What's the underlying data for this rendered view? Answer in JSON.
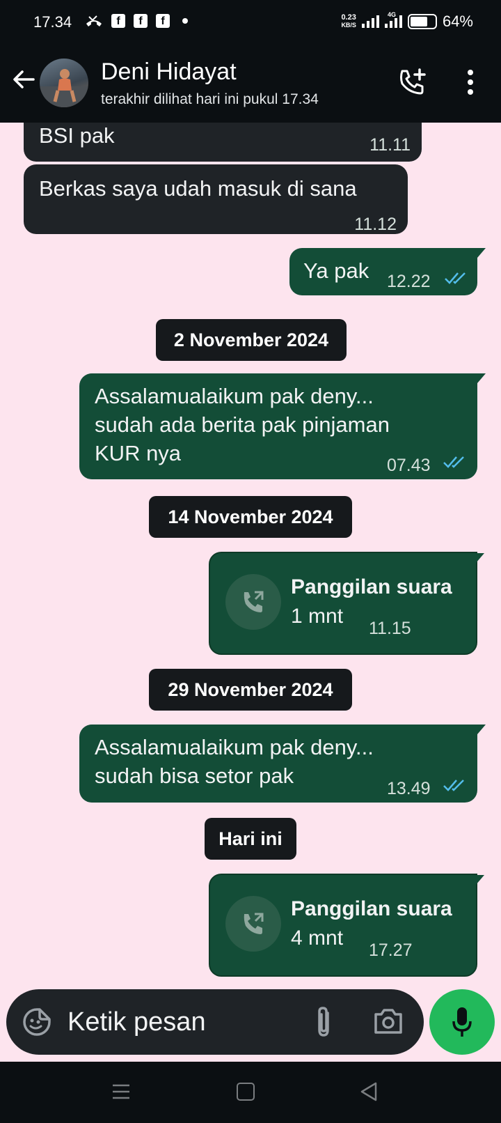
{
  "status_bar": {
    "time": "17.34",
    "speed_value": "0.23",
    "speed_unit": "KB/S",
    "network": "4G",
    "battery": "64%",
    "icons": [
      "missed-call-icon",
      "facebook-icon",
      "facebook-icon",
      "facebook-icon",
      "notification-dot-icon",
      "signal-icon",
      "signal-4g-icon",
      "battery-icon"
    ]
  },
  "header": {
    "contact_name": "Deni Hidayat",
    "last_seen": "terakhir dilihat hari ini pukul 17.34",
    "icons": [
      "back-arrow-icon",
      "add-call-icon",
      "more-vert-icon"
    ]
  },
  "messages": [
    {
      "dir": "in",
      "text": "BSI pak",
      "time": "11.11"
    },
    {
      "dir": "in",
      "text": "Berkas saya udah masuk di sana",
      "time": "11.12"
    },
    {
      "dir": "out",
      "text": "Ya pak",
      "time": "12.22",
      "read": true
    },
    {
      "date": "2 November 2024"
    },
    {
      "dir": "out",
      "lines": [
        "Assalamualaikum pak deny...",
        "sudah ada berita pak pinjaman",
        "KUR nya"
      ],
      "time": "07.43",
      "read": true
    },
    {
      "date": "14 November 2024"
    },
    {
      "dir": "out",
      "call": true,
      "title": "Panggilan suara",
      "duration": "1 mnt",
      "time": "11.15"
    },
    {
      "date": "29 November 2024"
    },
    {
      "dir": "out",
      "lines": [
        "Assalamualaikum pak deny...",
        "sudah bisa setor pak"
      ],
      "time": "13.49",
      "read": true
    },
    {
      "date": "Hari ini"
    },
    {
      "dir": "out",
      "call": true,
      "title": "Panggilan suara",
      "duration": "4 mnt",
      "time": "17.27"
    }
  ],
  "input": {
    "placeholder": "Ketik pesan",
    "icons": [
      "sticker-icon",
      "attach-icon",
      "camera-icon",
      "mic-icon"
    ]
  },
  "colors": {
    "chat_background": "#fde4ee",
    "incoming_bubble": "#1f2327",
    "outgoing_bubble": "#134d37",
    "read_ticks": "#53bdeb",
    "mic_button": "#22b95b"
  }
}
